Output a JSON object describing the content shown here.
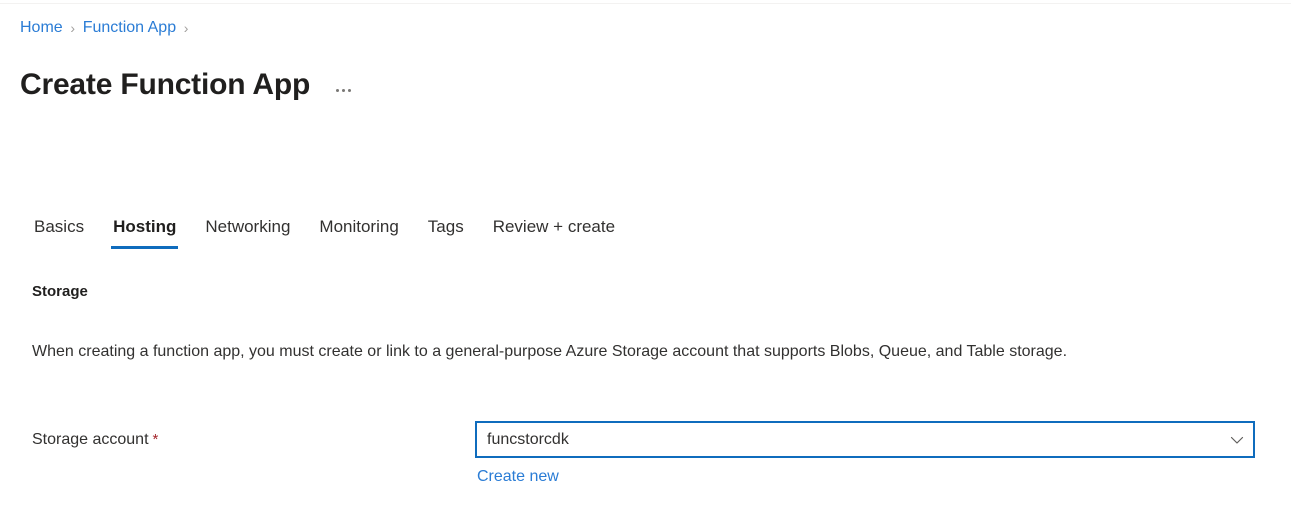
{
  "breadcrumb": {
    "items": [
      {
        "label": "Home"
      },
      {
        "label": "Function App"
      }
    ],
    "separator": "›"
  },
  "header": {
    "title": "Create Function App",
    "overflow_menu_name": "more-commands"
  },
  "tabs": [
    {
      "label": "Basics",
      "active": false
    },
    {
      "label": "Hosting",
      "active": true
    },
    {
      "label": "Networking",
      "active": false
    },
    {
      "label": "Monitoring",
      "active": false
    },
    {
      "label": "Tags",
      "active": false
    },
    {
      "label": "Review + create",
      "active": false
    }
  ],
  "section": {
    "heading": "Storage",
    "description_line1": "When creating a function app, you must create or link to a general-purpose Azure Storage account that supports Blobs,",
    "description_line2": "Queue, and Table storage."
  },
  "form": {
    "storage_account": {
      "label": "Storage account",
      "required_marker": "*",
      "value": "funcstorcdk",
      "placeholder": "",
      "create_new_label": "Create new",
      "chevron_icon": "chevron-down-icon"
    }
  },
  "colors": {
    "link": "#2a7cd5",
    "accent": "#0f6cbd",
    "required": "#a4262c",
    "text": "#323130",
    "heading": "#201f1e",
    "separator": "#a19f9d"
  }
}
